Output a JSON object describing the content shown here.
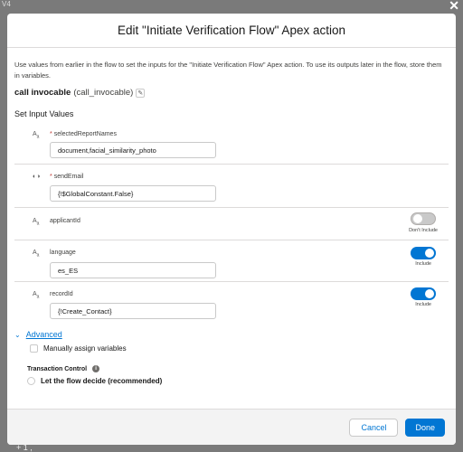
{
  "backdrop": {
    "corner_label": "V4",
    "bottom_label": "+ 1 ,",
    "close_icon": "close-icon"
  },
  "modal": {
    "title": "Edit \"Initiate Verification Flow\" Apex action",
    "description": "Use values from earlier in the flow to set the inputs for the \"Initiate Verification Flow\" Apex action. To use its outputs later in the flow, store them in variables.",
    "api_name_bold": "call invocable",
    "api_name_sub": "(call_invocable)",
    "section_title": "Set Input Values",
    "params": [
      {
        "type_icon": "A",
        "type_sub": "a",
        "required": "*",
        "label": "selectedReportNames",
        "value": "document,facial_similarity_photo"
      },
      {
        "type_icon": "ↀ",
        "required": "*",
        "label": "sendEmail",
        "value": "{!$GlobalConstant.False}"
      },
      {
        "type_icon": "A",
        "type_sub": "a",
        "label": "applicantId",
        "toggle_label": "Don't Include",
        "toggle_state": "off"
      },
      {
        "type_icon": "A",
        "type_sub": "a",
        "label": "language",
        "value": "es_ES",
        "toggle_label": "Include",
        "toggle_state": "on"
      },
      {
        "type_icon": "A",
        "type_sub": "a",
        "label": "recordId",
        "value": "{!Create_Contact}",
        "toggle_label": "Include",
        "toggle_state": "on"
      }
    ],
    "advanced_label": "Advanced",
    "manually_assign_label": "Manually assign variables",
    "transaction_control_label": "Transaction Control",
    "radio_label": "Let the flow decide (recommended)",
    "cancel_label": "Cancel",
    "done_label": "Done"
  },
  "colors": {
    "brand": "#0176d3",
    "required": "#c23934",
    "backdrop": "#7a7a7a"
  }
}
